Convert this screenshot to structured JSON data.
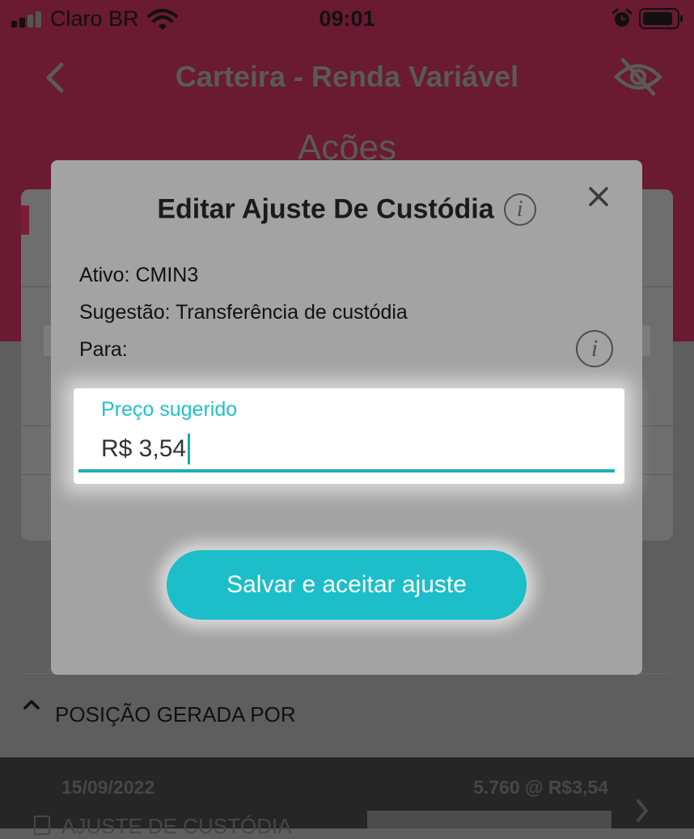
{
  "status_bar": {
    "carrier": "Claro BR",
    "time": "09:01"
  },
  "nav": {
    "title": "Carteira - Renda Variável",
    "section": "Ações"
  },
  "modal": {
    "title": "Editar Ajuste De Custódia",
    "info_glyph": "i",
    "close_glyph": "×",
    "ativo": "Ativo: CMIN3",
    "sugestao": "Sugestão: Transferência de custódia",
    "para": "Para:",
    "price_label": "Preço sugerido",
    "price_value": "R$ 3,54",
    "save_label": "Salvar e aceitar ajuste"
  },
  "position": {
    "label": "POSIÇÃO GERADA POR"
  },
  "entry": {
    "date": "15/09/2022",
    "quantity": "5.760 @ R$3,54",
    "kind": "AJUSTE DE CUSTÓDIA"
  },
  "colors": {
    "brand": "#6a1a32",
    "accent": "#1bbec9"
  },
  "icons": [
    "signal-icon",
    "wifi-icon",
    "alarm-icon",
    "battery-icon",
    "back-arrow-icon",
    "eye-off-icon",
    "info-icon",
    "close-icon",
    "chevron-up-icon",
    "document-icon",
    "chevron-right-icon"
  ]
}
